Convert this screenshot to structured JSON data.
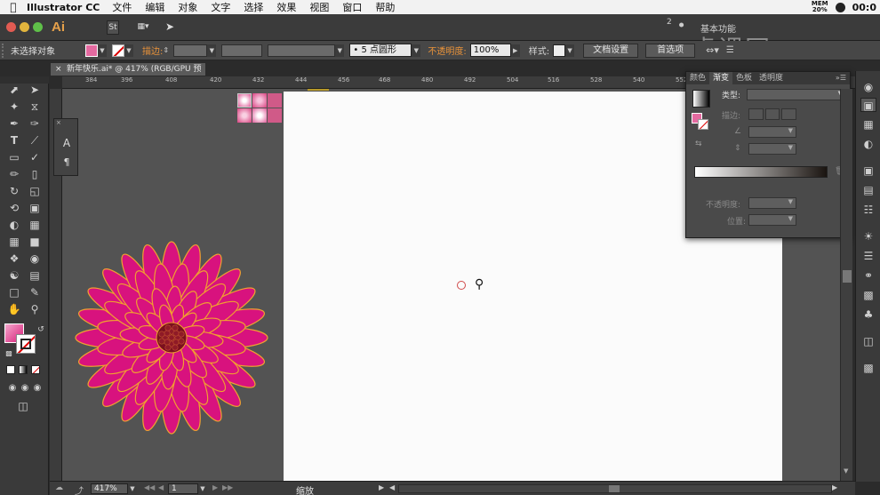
{
  "menubar": {
    "app_name": "Illustrator CC",
    "items": [
      "文件",
      "编辑",
      "对象",
      "文字",
      "选择",
      "效果",
      "视图",
      "窗口",
      "帮助"
    ],
    "mem_label": "MEM",
    "mem_value": "20%",
    "clock": "00:0"
  },
  "appbar": {
    "logo": "Ai",
    "doc_setup_badge": "St",
    "badge_count": "2",
    "workspace": "基本功能",
    "watermark": "虎课网"
  },
  "control": {
    "selection_status": "未选择对象",
    "stroke_label": "描边:",
    "brush_label": "5 点圆形",
    "opacity_label": "不透明度:",
    "opacity_value": "100%",
    "style_label": "样式:",
    "doc_setup_button": "文档设置",
    "prefs_button": "首选项"
  },
  "document": {
    "tab_title": "新年快乐.ai* @ 417% (RGB/GPU 预览)"
  },
  "rulers": {
    "top": [
      "384",
      "396",
      "408",
      "420",
      "432",
      "444",
      "456",
      "468",
      "480",
      "492",
      "504",
      "516",
      "528",
      "540",
      "552",
      "564",
      "576"
    ]
  },
  "gradient_panel": {
    "tabs": [
      "颜色",
      "渐变",
      "色板",
      "透明度"
    ],
    "active_tab": "渐变",
    "type_label": "类型:",
    "stroke_label": "描边:",
    "opacity_label": "不透明度:",
    "location_label": "位置:"
  },
  "status": {
    "zoom": "417%",
    "page": "1",
    "tool_name": "缩放"
  },
  "colors": {
    "accent_orange": "#e8923a",
    "flower_petal": "#d8127e",
    "flower_edge": "#f0a030",
    "flower_center": "#7a0f1e",
    "fill_swatch": "#e46aa0"
  }
}
